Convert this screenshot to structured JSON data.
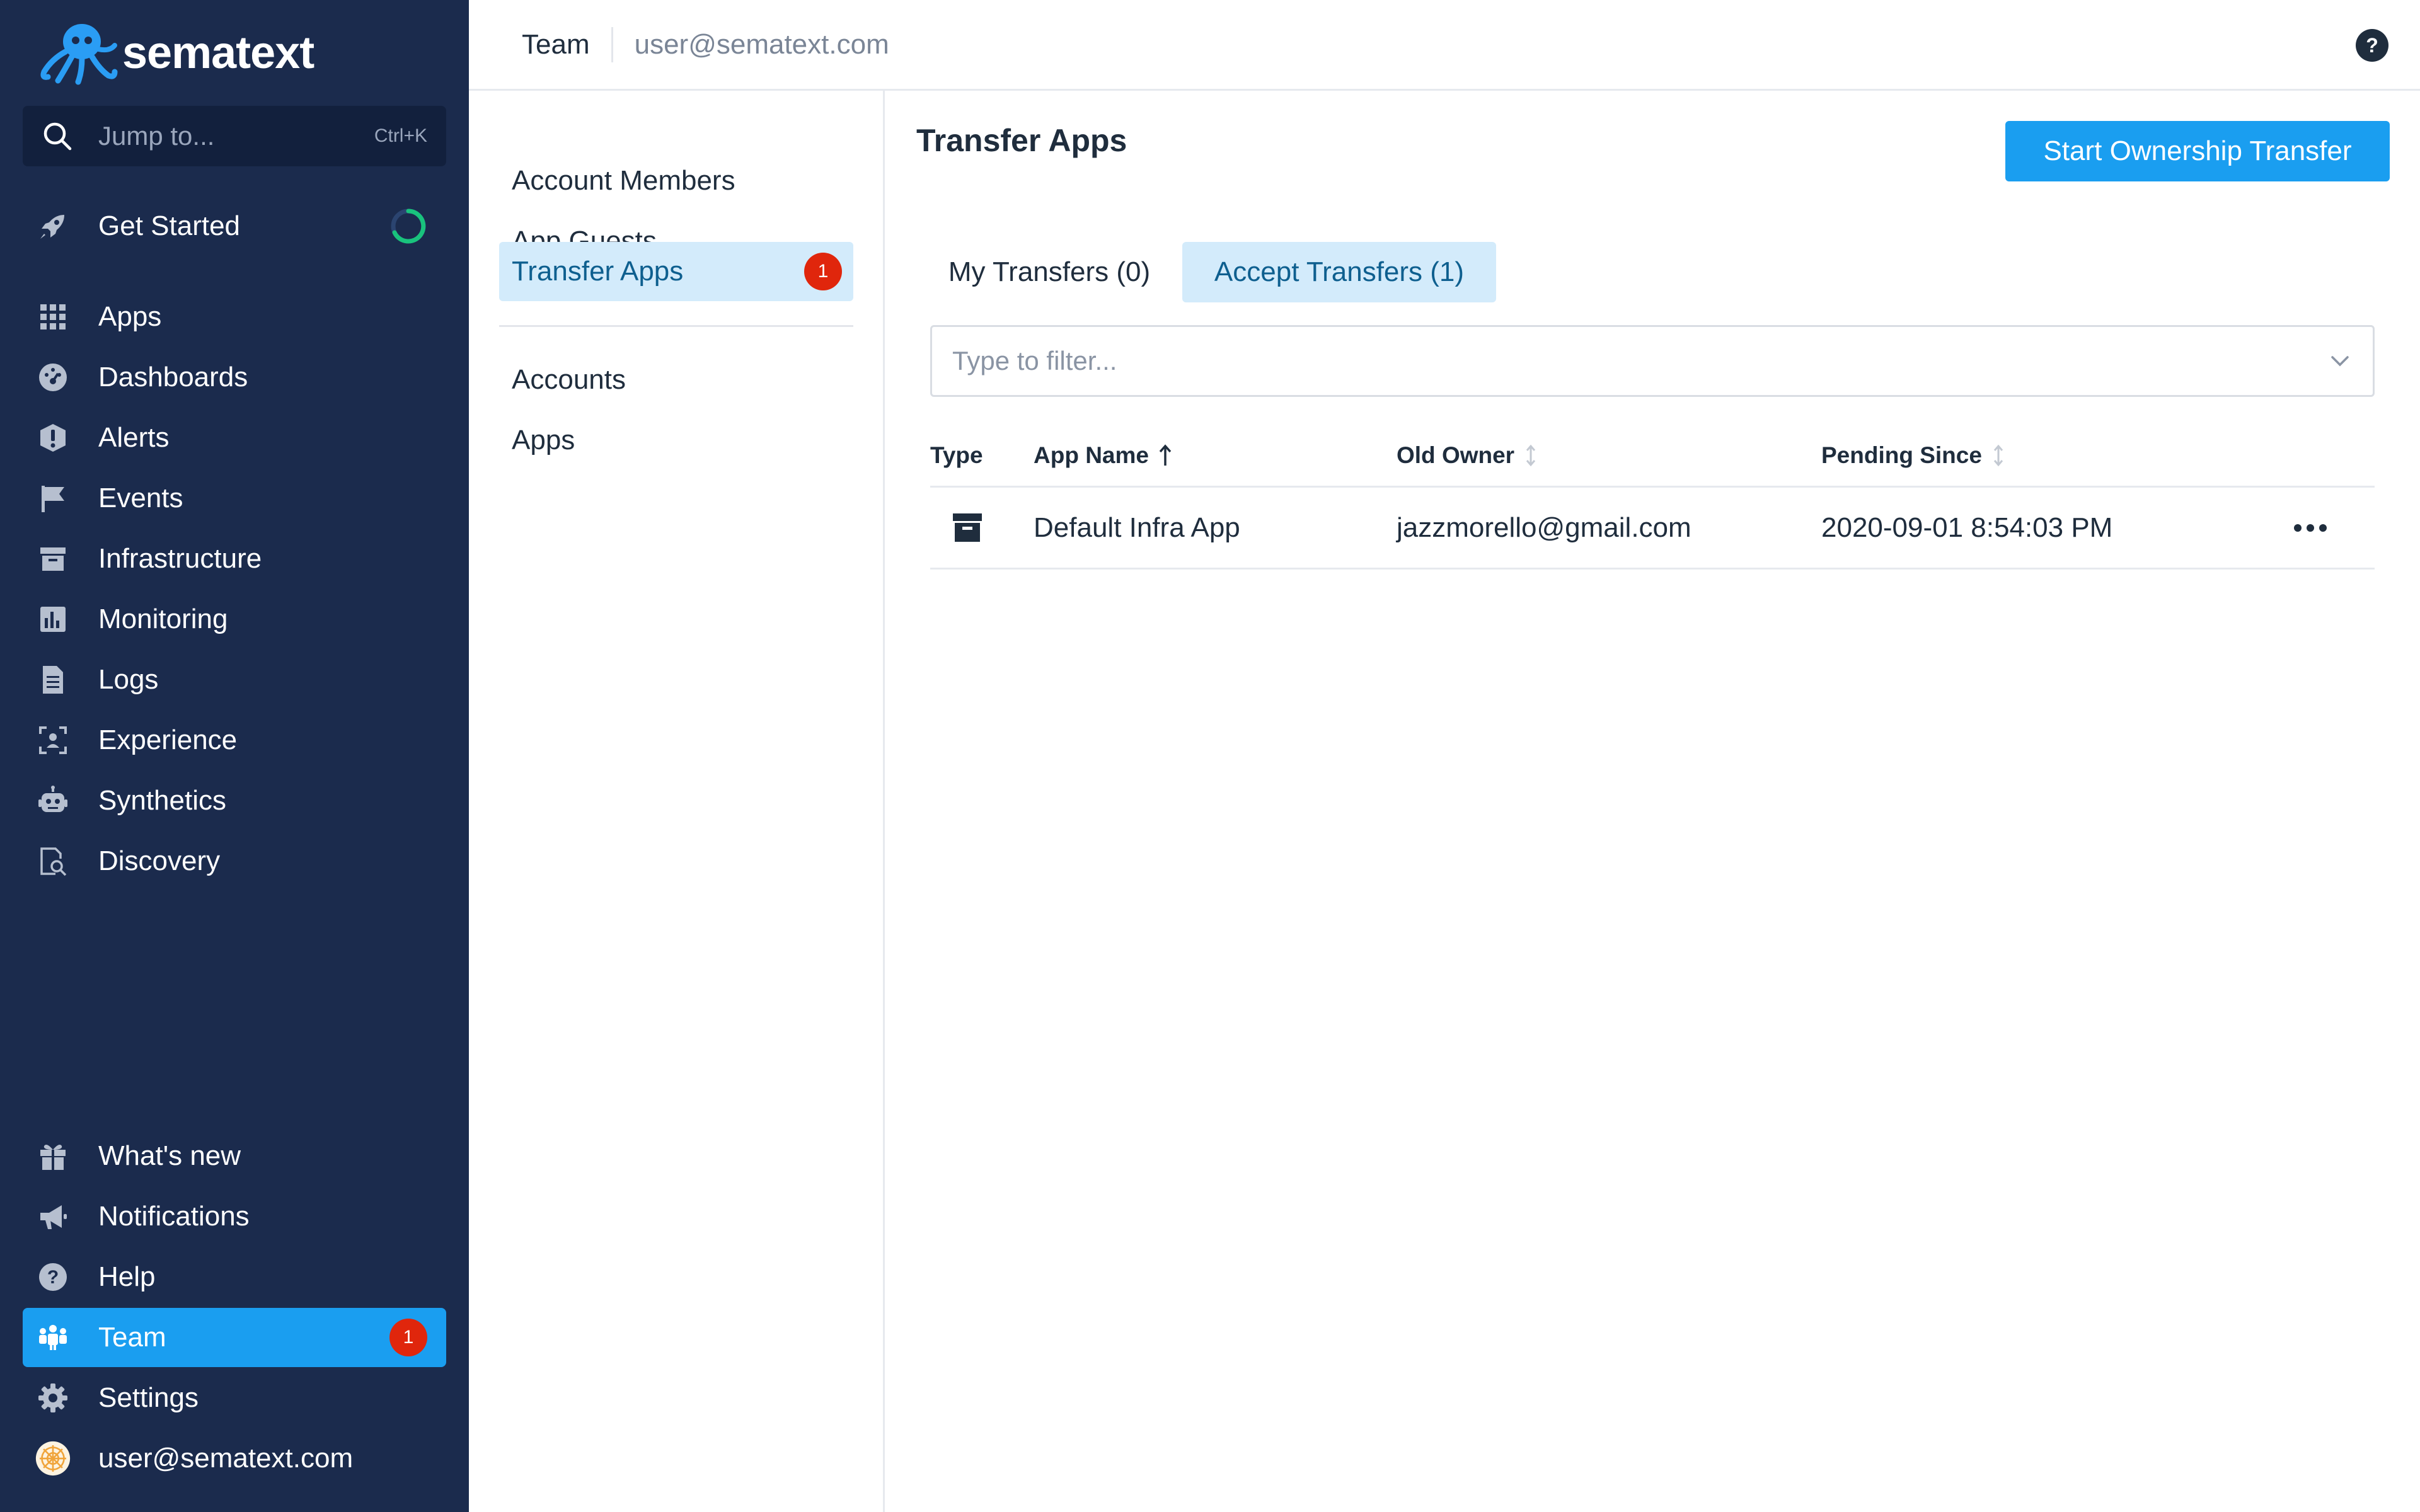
{
  "brand": {
    "name": "sematext"
  },
  "search": {
    "label": "Jump to...",
    "shortcut": "Ctrl+K"
  },
  "sidebar": {
    "get_started": "Get Started",
    "items": [
      {
        "label": "Apps",
        "icon": "grid-icon"
      },
      {
        "label": "Dashboards",
        "icon": "dashboard-icon"
      },
      {
        "label": "Alerts",
        "icon": "alert-icon"
      },
      {
        "label": "Events",
        "icon": "flag-icon"
      },
      {
        "label": "Infrastructure",
        "icon": "archive-icon"
      },
      {
        "label": "Monitoring",
        "icon": "bar-chart-icon"
      },
      {
        "label": "Logs",
        "icon": "document-icon"
      },
      {
        "label": "Experience",
        "icon": "user-focus-icon"
      },
      {
        "label": "Synthetics",
        "icon": "robot-icon"
      },
      {
        "label": "Discovery",
        "icon": "document-search-icon"
      }
    ],
    "bottom": {
      "whats_new": "What's new",
      "notifications": "Notifications",
      "help": "Help",
      "team": "Team",
      "team_badge": "1",
      "settings": "Settings",
      "user": "user@sematext.com"
    }
  },
  "header": {
    "title": "Team",
    "user": "user@sematext.com"
  },
  "subnav": {
    "items": [
      {
        "label": "Account Members"
      },
      {
        "label": "App Guests"
      },
      {
        "label": "Transfer Apps",
        "badge": "1"
      },
      {
        "label": "Accounts"
      },
      {
        "label": "Apps"
      }
    ]
  },
  "main": {
    "title": "Transfer Apps",
    "start_button": "Start Ownership Transfer",
    "tabs": [
      {
        "label": "My Transfers (0)"
      },
      {
        "label": "Accept Transfers (1)"
      }
    ],
    "filter_placeholder": "Type to filter...",
    "columns": [
      "Type",
      "App Name",
      "Old Owner",
      "Pending Since"
    ],
    "rows": [
      {
        "type_icon": "archive-icon",
        "app_name": "Default Infra App",
        "old_owner": "jazzmorello@gmail.com",
        "pending_since": "2020-09-01 8:54:03 PM"
      }
    ]
  },
  "colors": {
    "sidebar_bg": "#1b2b4d",
    "accent": "#1a9ef0",
    "active_tab_bg": "#d3ebfb",
    "badge": "#e0260c"
  }
}
